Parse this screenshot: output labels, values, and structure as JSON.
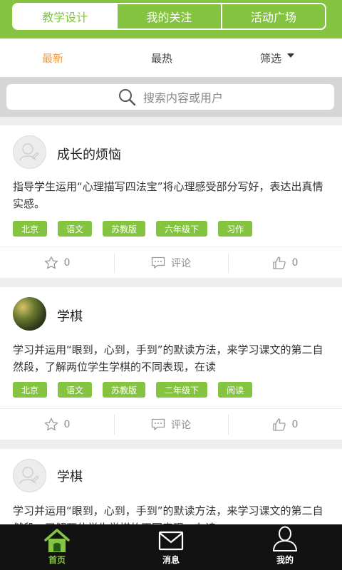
{
  "tabs": [
    {
      "label": "教学设计",
      "active": true
    },
    {
      "label": "我的关注",
      "active": false
    },
    {
      "label": "活动广场",
      "active": false
    }
  ],
  "sort": {
    "latest": "最新",
    "hottest": "最热",
    "filter": "筛选"
  },
  "search": {
    "placeholder": "搜索内容或用户"
  },
  "posts": [
    {
      "title": "成长的烦恼",
      "avatar": "default",
      "desc": "指导学生运用“心理描写四法宝”将心理感受部分写好，表达出真情实感。",
      "tags": [
        "北京",
        "语文",
        "苏教版",
        "六年级下",
        "习作"
      ],
      "stars": "0",
      "comment_label": "评论",
      "likes": "0"
    },
    {
      "title": "学棋",
      "avatar": "photo",
      "desc": "学习并运用“眼到，心到，手到”的默读方法，来学习课文的第二自然段，了解两位学生学棋的不同表现，在读",
      "tags": [
        "北京",
        "语文",
        "苏教版",
        "二年级下",
        "阅读"
      ],
      "stars": "0",
      "comment_label": "评论",
      "likes": "0"
    },
    {
      "title": "学棋",
      "avatar": "default",
      "desc": "学习并运用“眼到，心到，手到”的默读方法，来学习课文的第二自然段，了解两位学生学棋的不同表现，在读"
    }
  ],
  "bottom_nav": [
    {
      "label": "首页",
      "icon": "home-icon",
      "active": true
    },
    {
      "label": "消息",
      "icon": "envelope-icon",
      "active": false
    },
    {
      "label": "我的",
      "icon": "user-icon",
      "active": false
    }
  ],
  "colors": {
    "accent": "#84c441",
    "highlight": "#f39c3c",
    "nav_bg": "#121212"
  }
}
